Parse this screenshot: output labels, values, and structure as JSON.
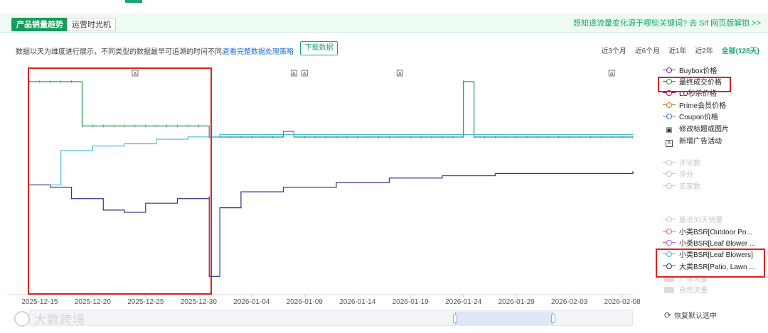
{
  "tabs": [
    {
      "label": "产品销量趋势",
      "active": true
    },
    {
      "label": "运营时光机",
      "active": false
    }
  ],
  "promo_text": "想知道流量变化源于哪些关键词? 去 Sif 网页版解锁 >>",
  "info": {
    "description": "数据以天为维度进行展示，不同类型的数据最早可追溯的时间不同。",
    "link": "查看完整数据处理策略",
    "download_label": "下载数据"
  },
  "ranges": [
    {
      "label": "近3个月",
      "selected": false
    },
    {
      "label": "近6个月",
      "selected": false
    },
    {
      "label": "近1年",
      "selected": false
    },
    {
      "label": "近2年",
      "selected": false
    },
    {
      "label": "全部(128天)",
      "selected": true
    }
  ],
  "event_marker_glyph": "A",
  "legend": [
    {
      "label": "Buybox价格",
      "marker": "circle",
      "color": "#5a2fb5",
      "enabled": true
    },
    {
      "label": "最终成交价格",
      "marker": "circle",
      "color": "#1a9b4a",
      "enabled": true
    },
    {
      "label": "LD秒杀价格",
      "marker": "circle",
      "color": "#b8144f",
      "enabled": true
    },
    {
      "label": "Prime会员价格",
      "marker": "circle",
      "color": "#e0731a",
      "enabled": true
    },
    {
      "label": "Coupon价格",
      "marker": "circle",
      "color": "#3e6fd8",
      "enabled": true
    },
    {
      "label": "修改标题或图片",
      "marker": "image-icon",
      "color": "#333333",
      "enabled": true
    },
    {
      "label": "新增广告活动",
      "marker": "ad-icon",
      "color": "#333333",
      "enabled": true
    },
    {
      "label": "评论数",
      "marker": "circle",
      "color": "#c6c6c6",
      "enabled": false
    },
    {
      "label": "评分",
      "marker": "circle",
      "color": "#c6c6c6",
      "enabled": false
    },
    {
      "label": "卖家数",
      "marker": "circle",
      "color": "#c6c6c6",
      "enabled": false
    },
    {
      "label": "最近30天销量",
      "marker": "circle",
      "color": "#c6c6c6",
      "enabled": false
    },
    {
      "label": "小类BSR[Outdoor Po...",
      "marker": "circle",
      "color": "#e04fb3",
      "enabled": true
    },
    {
      "label": "小类BSR[Leaf Blower ...",
      "marker": "circle",
      "color": "#b066e0",
      "enabled": true
    },
    {
      "label": "小类BSR[Leaf Blowers]",
      "marker": "circle",
      "color": "#46b7ea",
      "enabled": true
    },
    {
      "label": "大类BSR[Patio, Lawn ...",
      "marker": "circle",
      "color": "#3b2f8a",
      "enabled": true
    },
    {
      "label": "广告流量",
      "marker": "bar",
      "color": "#dcdcdc",
      "enabled": false
    },
    {
      "label": "自然流量",
      "marker": "bar",
      "color": "#dcdcdc",
      "enabled": false
    }
  ],
  "restore_label": "恢复默认选中",
  "watermark": "大数跨境",
  "chart_data": {
    "type": "line",
    "x_ticks": [
      "2025-12-15",
      "2025-12-20",
      "2025-12-25",
      "2025-12-30",
      "2026-01-04",
      "2026-01-09",
      "2026-01-14",
      "2026-01-19",
      "2026-01-24",
      "2026-01-29",
      "2026-02-03",
      "2026-02-08"
    ],
    "x_range": [
      "2025-12-14",
      "2026-02-09"
    ],
    "event_dates": [
      "2025-12-24",
      "2026-01-08",
      "2026-01-09",
      "2026-01-18",
      "2026-02-07"
    ],
    "series": [
      {
        "name": "最终成交价格",
        "color": "#1a9b4a",
        "step": true,
        "points": [
          [
            "2025-12-14",
            0.0
          ],
          [
            "2025-12-19",
            -0.08
          ],
          [
            "2025-12-31",
            -0.1
          ],
          [
            "2026-01-07",
            -0.09
          ],
          [
            "2026-01-08",
            -0.1
          ],
          [
            "2026-01-24",
            0.0
          ],
          [
            "2026-01-25",
            -0.1
          ],
          [
            "2026-02-09",
            -0.1
          ]
        ]
      },
      {
        "name": "小类BSR[Leaf Blowers]",
        "color": "#46b7ea",
        "step": true,
        "points": [
          [
            "2025-12-14",
            0.52
          ],
          [
            "2025-12-16",
            0.52
          ],
          [
            "2025-12-17",
            0.37
          ],
          [
            "2025-12-20",
            0.35
          ],
          [
            "2025-12-23",
            0.34
          ],
          [
            "2025-12-26",
            0.32
          ],
          [
            "2025-12-29",
            0.31
          ],
          [
            "2026-01-01",
            0.3
          ],
          [
            "2026-01-10",
            0.3
          ],
          [
            "2026-02-09",
            0.3
          ]
        ]
      },
      {
        "name": "大类BSR[Patio, Lawn ...",
        "color": "#3b2f8a",
        "step": true,
        "points": [
          [
            "2025-12-14",
            0.52
          ],
          [
            "2025-12-16",
            0.53
          ],
          [
            "2025-12-18",
            0.58
          ],
          [
            "2025-12-21",
            0.63
          ],
          [
            "2025-12-23",
            0.64
          ],
          [
            "2025-12-25",
            0.6
          ],
          [
            "2025-12-28",
            0.58
          ],
          [
            "2025-12-31",
            0.57
          ],
          [
            "2025-12-31",
            0.92
          ],
          [
            "2026-01-01",
            0.92
          ],
          [
            "2026-01-01",
            0.62
          ],
          [
            "2026-01-03",
            0.55
          ],
          [
            "2026-01-07",
            0.53
          ],
          [
            "2026-01-12",
            0.51
          ],
          [
            "2026-01-17",
            0.49
          ],
          [
            "2026-01-22",
            0.48
          ],
          [
            "2026-01-27",
            0.47
          ],
          [
            "2026-02-01",
            0.47
          ],
          [
            "2026-02-09",
            0.46
          ]
        ]
      }
    ]
  }
}
